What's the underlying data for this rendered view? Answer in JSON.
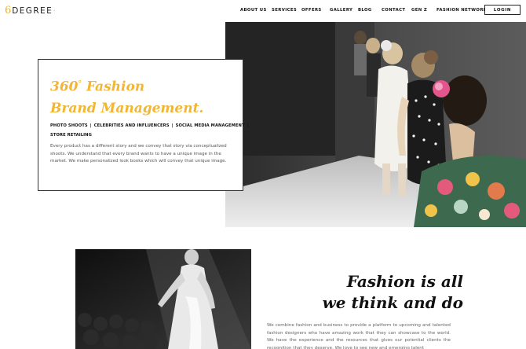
{
  "brand": {
    "number": "6",
    "word": "DEGREE",
    "superscript": "°",
    "accent_color": "#f2b633"
  },
  "nav": {
    "items": [
      {
        "label": "ABOUT US"
      },
      {
        "label": "SERVICES"
      },
      {
        "label": "OFFERS"
      },
      {
        "label": "GALLERY"
      },
      {
        "label": "BLOG"
      },
      {
        "label": "CONTACT"
      },
      {
        "label": "GEN Z"
      },
      {
        "label": "FASHION NETWORK"
      }
    ],
    "login_label": "LOGIN"
  },
  "hero": {
    "title_line1_prefix": "360",
    "title_degree": "°",
    "title_line1_rest": " Fashion",
    "title_line2": "Brand Management.",
    "services": [
      "PHOTO SHOOTS",
      "CELEBRITIES AND INFLUENCERS",
      "SOCIAL MEDIA MANAGEMENT",
      "STORE RETAILING"
    ],
    "separator": "|",
    "description": "Every product has a different story and we convey that story via conceptualized shoots. We understand that every brand wants to have a unique image in the market. We make personalized look books which will convey that unique image.",
    "photo_icon": "fashion-runway-photo"
  },
  "second": {
    "title_line1": "Fashion is all",
    "title_line2": "we think and do",
    "description": "We combine fashion and business to provide a platform to upcoming and talented fashion designers who have amazing work that they can showcase to the world. We have the experience and the resources that gives our potential clients the recognition that they deserve. We love to see new and emerging talent",
    "photo_icon": "runway-model-bw-photo"
  }
}
